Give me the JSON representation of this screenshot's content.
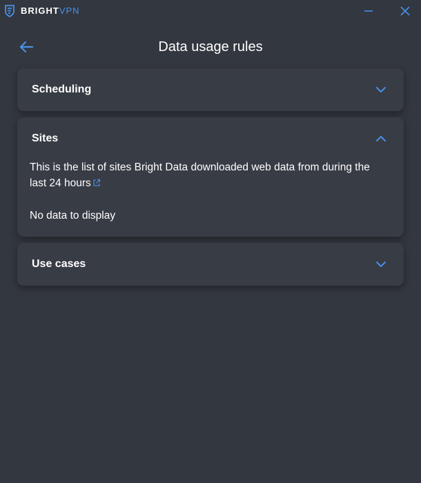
{
  "app": {
    "brand_primary": "BRIGHT",
    "brand_secondary": "VPN",
    "logo_icon": "shield-logo-icon",
    "accent_color": "#4a90e8",
    "background_color": "#33373f",
    "card_color": "#383c45"
  },
  "window_controls": {
    "minimize_icon": "minimize-icon",
    "close_icon": "close-icon"
  },
  "header": {
    "back_icon": "arrow-left-icon",
    "title": "Data usage rules"
  },
  "sections": {
    "scheduling": {
      "title": "Scheduling",
      "expanded": false,
      "icon": "chevron-down-icon"
    },
    "sites": {
      "title": "Sites",
      "expanded": true,
      "icon": "chevron-up-icon",
      "description": "This is the list of sites Bright Data downloaded web data from during the last 24 hours",
      "link_icon": "external-link-icon",
      "empty_text": "No data to display"
    },
    "use_cases": {
      "title": "Use cases",
      "expanded": false,
      "icon": "chevron-down-icon"
    }
  }
}
